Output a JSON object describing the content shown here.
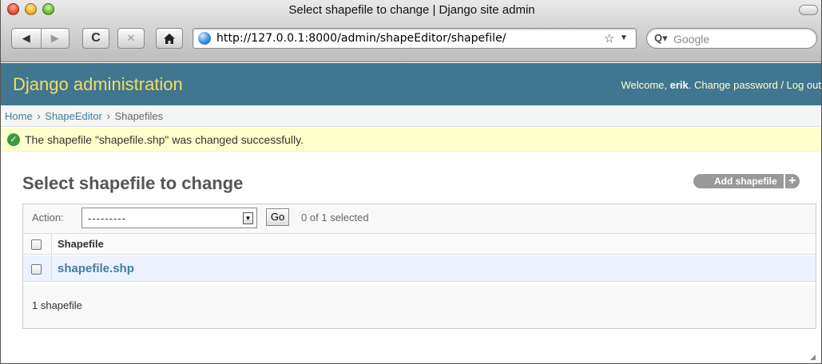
{
  "window": {
    "title": "Select shapefile to change | Django site admin"
  },
  "toolbar": {
    "url": "http://127.0.0.1:8000/admin/shapeEditor/shapefile/",
    "search_placeholder": "Google",
    "icons": [
      "back-icon",
      "forward-icon",
      "reload-icon",
      "stop-icon",
      "home-icon",
      "globe-icon",
      "bookmark-star-icon",
      "search-icon"
    ]
  },
  "header": {
    "site_name": "Django administration",
    "welcome": "Welcome, ",
    "username": "erik",
    "welcome_end": ". ",
    "change_password": "Change password",
    "separator": " / ",
    "logout": "Log out"
  },
  "breadcrumbs": {
    "items": [
      "Home",
      "ShapeEditor",
      "Shapefiles"
    ],
    "separator": "›"
  },
  "message": {
    "text": "The shapefile \"shapefile.shp\" was changed successfully."
  },
  "content": {
    "title": "Select shapefile to change",
    "add_button": "Add shapefile",
    "add_plus": "+"
  },
  "actions": {
    "label": "Action:",
    "selected_value": "---------",
    "go_label": "Go",
    "counter": "0 of 1 selected"
  },
  "table": {
    "column": "Shapefile",
    "rows": [
      {
        "name": "shapefile.shp"
      }
    ]
  },
  "paginator": {
    "text": "1 shapefile"
  }
}
